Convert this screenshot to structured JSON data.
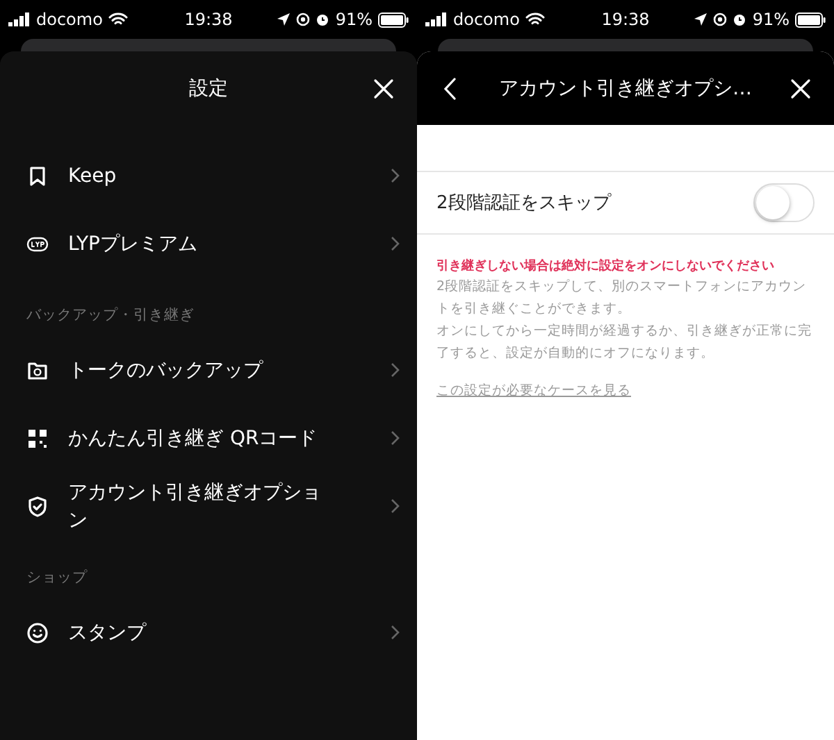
{
  "screens": [
    {
      "status_bar": {
        "carrier": "docomo",
        "time": "19:38",
        "battery": "91%"
      },
      "title": "設定",
      "sections": [
        {
          "items": [
            {
              "label": "Keep"
            },
            {
              "label": "LYPプレミアム"
            }
          ]
        },
        {
          "header": "バックアップ・引き継ぎ",
          "items": [
            {
              "label": "トークのバックアップ"
            },
            {
              "label": "かんたん引き継ぎ QRコード"
            },
            {
              "label": "アカウント引き継ぎオプション"
            }
          ]
        },
        {
          "header": "ショップ",
          "items": [
            {
              "label": "スタンプ"
            }
          ]
        }
      ]
    },
    {
      "status_bar": {
        "carrier": "docomo",
        "time": "19:38",
        "battery": "91%"
      },
      "title": "アカウント引き継ぎオプシ…",
      "toggle": {
        "label": "2段階認証をスキップ",
        "on": false
      },
      "warning": "引き継ぎしない場合は絶対に設定をオンにしないでください",
      "description": [
        "2段階認証をスキップして、別のスマートフォンにアカウントを引き継ぐことができます。",
        "オンにしてから一定時間が経過するか、引き継ぎが正常に完了すると、設定が自動的にオフになります。"
      ],
      "link": "この設定が必要なケースを見る"
    }
  ]
}
